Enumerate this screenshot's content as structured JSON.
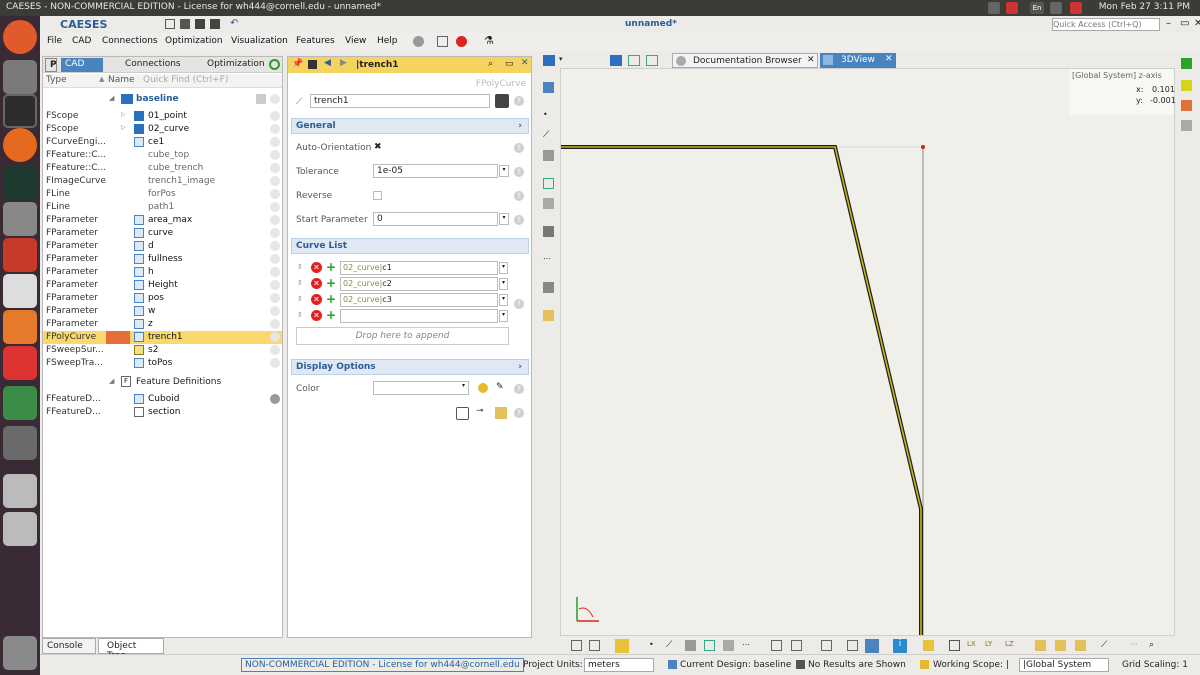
{
  "system": {
    "window_title": "CAESES - NON-COMMERCIAL EDITION - License for wh444@cornell.edu - unnamed*",
    "clock": "Mon Feb 27  3:11 PM",
    "lang": "En"
  },
  "app": {
    "doc_title": "unnamed*",
    "quick_access_placeholder": "Quick Access (Ctrl+Q)",
    "logo_text": "CAESES"
  },
  "menu": [
    "File",
    "CAD",
    "Connections",
    "Optimization",
    "Visualization",
    "Features",
    "View",
    "Help"
  ],
  "left": {
    "tabs": [
      "CAD",
      "Connections",
      "Optimization"
    ],
    "col_type": "Type",
    "col_name": "Name",
    "quick_find": "Quick Find (Ctrl+F)",
    "root": "baseline",
    "rows": [
      {
        "type": "FScope",
        "name": "01_point"
      },
      {
        "type": "FScope",
        "name": "02_curve"
      },
      {
        "type": "FCurveEngi...",
        "name": "ce1"
      },
      {
        "type": "FFeature::C...",
        "name": "cube_top"
      },
      {
        "type": "FFeature::C...",
        "name": "cube_trench"
      },
      {
        "type": "FImageCurve",
        "name": "trench1_image"
      },
      {
        "type": "FLine",
        "name": "forPos"
      },
      {
        "type": "FLine",
        "name": "path1"
      },
      {
        "type": "FParameter",
        "name": "area_max"
      },
      {
        "type": "FParameter",
        "name": "curve"
      },
      {
        "type": "FParameter",
        "name": "d"
      },
      {
        "type": "FParameter",
        "name": "fullness"
      },
      {
        "type": "FParameter",
        "name": "h"
      },
      {
        "type": "FParameter",
        "name": "Height"
      },
      {
        "type": "FParameter",
        "name": "pos"
      },
      {
        "type": "FParameter",
        "name": "w"
      },
      {
        "type": "FParameter",
        "name": "z"
      },
      {
        "type": "FPolyCurve",
        "name": "trench1"
      },
      {
        "type": "FSweepSur...",
        "name": "s2"
      },
      {
        "type": "FSweepTra...",
        "name": "toPos"
      }
    ],
    "feature_definitions": "Feature Definitions",
    "features": [
      {
        "type": "FFeatureD...",
        "name": "Cuboid"
      },
      {
        "type": "FFeatureD...",
        "name": "section"
      }
    ],
    "bottom_tabs": [
      "Console",
      "Object Tree"
    ]
  },
  "props": {
    "header": "|trench1",
    "class": "FPolyCurve",
    "name": "trench1",
    "general": "General",
    "auto_orientation": "Auto-Orientation",
    "tolerance_label": "Tolerance",
    "tolerance": "1e-05",
    "reverse": "Reverse",
    "start_param_label": "Start Parameter",
    "start_param": "0",
    "curve_list": "Curve List",
    "curves": [
      {
        "scope": "02_curve|",
        "name": "c1"
      },
      {
        "scope": "02_curve|",
        "name": "c2"
      },
      {
        "scope": "02_curve|",
        "name": "c3"
      }
    ],
    "drop_hint": "Drop here to append",
    "display_options": "Display Options",
    "color": "Color"
  },
  "view": {
    "tabs": [
      "Documentation Browser",
      "3DView"
    ],
    "coord_title": "[Global System] z-axis",
    "x_label": "x:",
    "x_val": "0.101",
    "y_label": "y:",
    "y_val": "-0.001"
  },
  "status": {
    "license": "NON-COMMERCIAL EDITION - License for wh444@cornell.edu",
    "units_label": "Project Units:",
    "units": "meters",
    "design": "Current Design: baseline",
    "results": "No Results are Shown",
    "scope": "Working Scope: |",
    "system": "|Global System",
    "grid": "Grid Scaling: 1"
  },
  "colors": {
    "accent": "#f4d35e",
    "select": "#f9d96b",
    "link": "#2a5e98",
    "orange": "#e46e3a",
    "curve": "#c9b422"
  }
}
